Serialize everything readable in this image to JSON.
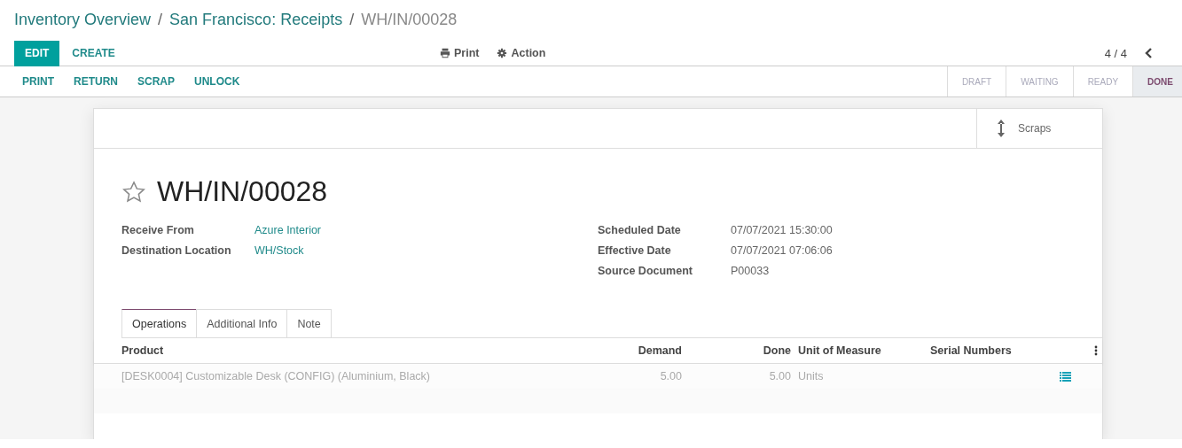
{
  "breadcrumb": [
    {
      "label": "Inventory Overview",
      "current": false
    },
    {
      "label": "San Francisco: Receipts",
      "current": false
    },
    {
      "label": "WH/IN/00028",
      "current": true
    }
  ],
  "separator": "/",
  "buttons": [
    {
      "label": "EDIT",
      "primary": true
    },
    {
      "label": "CREATE",
      "primary": false
    }
  ],
  "actions": [
    {
      "label": "Print",
      "kind": "print"
    },
    {
      "label": "Action",
      "kind": "gear"
    }
  ],
  "pager": "4 / 4",
  "header_buttons": [
    "PRINT",
    "RETURN",
    "SCRAP",
    "UNLOCK"
  ],
  "stages": [
    {
      "label": "DRAFT",
      "selected": false
    },
    {
      "label": "WAITING",
      "selected": false
    },
    {
      "label": "READY",
      "selected": false
    },
    {
      "label": "DONE",
      "selected": true
    }
  ],
  "smart_button": {
    "label": "Scraps"
  },
  "record": {
    "title": "WH/IN/00028",
    "starred": false
  },
  "left_fields": [
    {
      "label": "Receive From",
      "value": "Azure Interior",
      "link": true
    },
    {
      "label": "Destination Location",
      "value": "WH/Stock",
      "link": true
    }
  ],
  "right_fields": [
    {
      "label": "Scheduled Date",
      "value": "07/07/2021 15:30:00",
      "link": false
    },
    {
      "label": "Effective Date",
      "value": "07/07/2021 07:06:06",
      "link": false
    },
    {
      "label": "Source Document",
      "value": "P00033",
      "link": false
    }
  ],
  "tabs": [
    {
      "label": "Operations",
      "selected": true
    },
    {
      "label": "Additional Info",
      "selected": false
    },
    {
      "label": "Note",
      "selected": false
    }
  ],
  "table": {
    "columns": [
      {
        "label": "Product"
      },
      {
        "label": "Demand"
      },
      {
        "label": "Done"
      },
      {
        "label": "Unit of Measure"
      },
      {
        "label": "Serial Numbers"
      }
    ],
    "rows": [
      {
        "cells": [
          "[DESK0004] Customizable Desk (CONFIG) (Aluminium, Black)",
          "5.00",
          "5.00",
          "Units"
        ]
      }
    ]
  }
}
